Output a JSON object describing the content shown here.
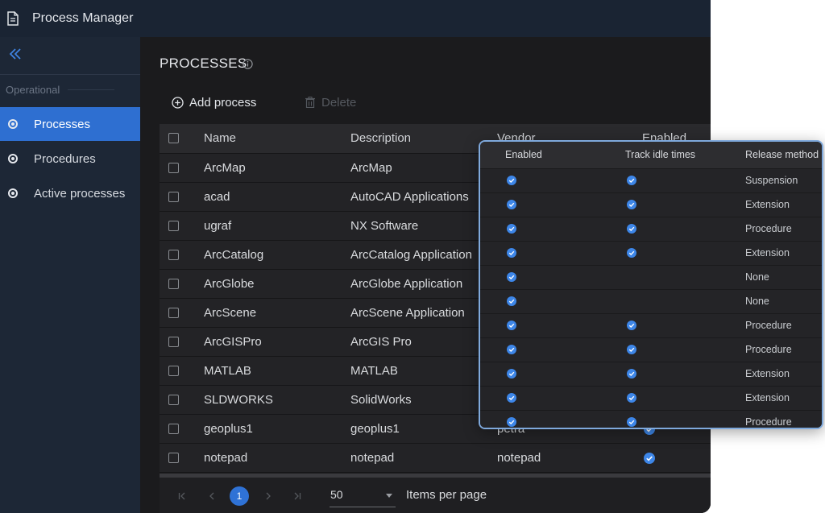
{
  "app": {
    "title": "Process Manager"
  },
  "sidebar": {
    "section": "Operational",
    "items": [
      {
        "label": "Processes",
        "active": true
      },
      {
        "label": "Procedures",
        "active": false
      },
      {
        "label": "Active processes",
        "active": false
      }
    ]
  },
  "page": {
    "title": "PROCESSES",
    "add_label": "Add process",
    "delete_label": "Delete"
  },
  "table": {
    "headers": {
      "name": "Name",
      "description": "Description",
      "vendor": "Vendor",
      "enabled": "Enabled"
    },
    "rows": [
      {
        "name": "ArcMap",
        "description": "ArcMap",
        "vendor": "",
        "enabled": true
      },
      {
        "name": "acad",
        "description": "AutoCAD Applications",
        "vendor": "",
        "enabled": true
      },
      {
        "name": "ugraf",
        "description": "NX Software",
        "vendor": "",
        "enabled": true
      },
      {
        "name": "ArcCatalog",
        "description": "ArcCatalog Application",
        "vendor": "",
        "enabled": true
      },
      {
        "name": "ArcGlobe",
        "description": "ArcGlobe Application",
        "vendor": "",
        "enabled": true
      },
      {
        "name": "ArcScene",
        "description": "ArcScene Application",
        "vendor": "",
        "enabled": true
      },
      {
        "name": "ArcGISPro",
        "description": "ArcGIS Pro",
        "vendor": "",
        "enabled": true
      },
      {
        "name": "MATLAB",
        "description": "MATLAB",
        "vendor": "",
        "enabled": true
      },
      {
        "name": "SLDWORKS",
        "description": "SolidWorks",
        "vendor": "",
        "enabled": true
      },
      {
        "name": "geoplus1",
        "description": "geoplus1",
        "vendor": "petra",
        "enabled": true
      },
      {
        "name": "notepad",
        "description": "notepad",
        "vendor": "notepad",
        "enabled": true
      }
    ]
  },
  "pagination": {
    "current_page": "1",
    "page_size": "50",
    "page_size_label": "Items per page"
  },
  "overlay": {
    "headers": {
      "enabled": "Enabled",
      "track": "Track idle times",
      "release": "Release method"
    },
    "rows": [
      {
        "enabled": true,
        "track": true,
        "release": "Suspension"
      },
      {
        "enabled": true,
        "track": true,
        "release": "Extension"
      },
      {
        "enabled": true,
        "track": true,
        "release": "Procedure"
      },
      {
        "enabled": true,
        "track": true,
        "release": "Extension"
      },
      {
        "enabled": true,
        "track": false,
        "release": "None"
      },
      {
        "enabled": true,
        "track": false,
        "release": "None"
      },
      {
        "enabled": true,
        "track": true,
        "release": "Procedure"
      },
      {
        "enabled": true,
        "track": true,
        "release": "Procedure"
      },
      {
        "enabled": true,
        "track": true,
        "release": "Extension"
      },
      {
        "enabled": true,
        "track": true,
        "release": "Extension"
      },
      {
        "enabled": true,
        "track": true,
        "release": "Procedure"
      }
    ]
  },
  "colors": {
    "accent": "#2e6fd1",
    "check": "#3d86e8",
    "overlay_border": "#7fa9dc"
  }
}
